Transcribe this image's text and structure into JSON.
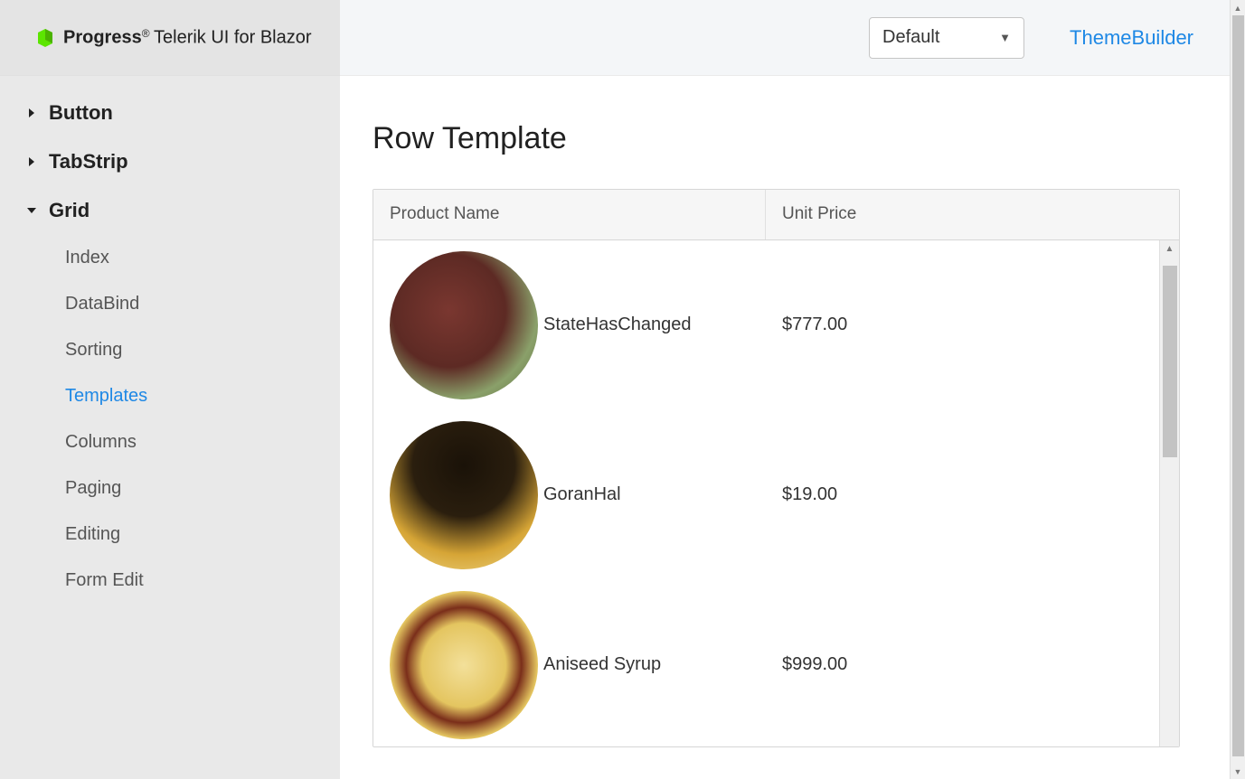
{
  "brand": {
    "logo_strong": "Progress",
    "logo_product": "Telerik UI for Blazor"
  },
  "sidebar": {
    "items": [
      {
        "label": "Button",
        "expanded": false
      },
      {
        "label": "TabStrip",
        "expanded": false
      },
      {
        "label": "Grid",
        "expanded": true,
        "children": [
          {
            "label": "Index"
          },
          {
            "label": "DataBind"
          },
          {
            "label": "Sorting"
          },
          {
            "label": "Templates",
            "active": true
          },
          {
            "label": "Columns"
          },
          {
            "label": "Paging"
          },
          {
            "label": "Editing"
          },
          {
            "label": "Form Edit"
          }
        ]
      }
    ]
  },
  "topbar": {
    "theme_selected": "Default",
    "themebuilder_label": "ThemeBuilder"
  },
  "page": {
    "title": "Row Template"
  },
  "grid": {
    "columns": {
      "product_name": "Product Name",
      "unit_price": "Unit Price"
    },
    "rows": [
      {
        "name": "StateHasChanged",
        "price": "$777.00",
        "img_class": "prod1"
      },
      {
        "name": "GoranHal",
        "price": "$19.00",
        "img_class": "prod2"
      },
      {
        "name": "Aniseed Syrup",
        "price": "$999.00",
        "img_class": "prod3"
      }
    ]
  }
}
